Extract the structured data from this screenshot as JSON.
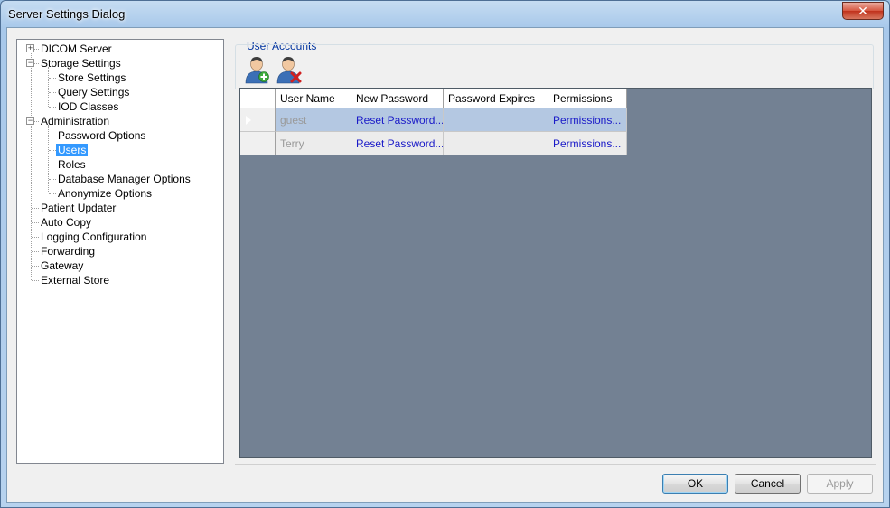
{
  "window": {
    "title": "Server Settings Dialog",
    "close_glyph": "✕"
  },
  "tree": {
    "nodes": [
      {
        "label": "DICOM Server",
        "level": 0,
        "expander": "+"
      },
      {
        "label": "Storage Settings",
        "level": 0,
        "expander": "−"
      },
      {
        "label": "Store Settings",
        "level": 1
      },
      {
        "label": "Query Settings",
        "level": 1
      },
      {
        "label": "IOD Classes",
        "level": 1
      },
      {
        "label": "Administration",
        "level": 0,
        "expander": "−"
      },
      {
        "label": "Password Options",
        "level": 1
      },
      {
        "label": "Users",
        "level": 1,
        "selected": true
      },
      {
        "label": "Roles",
        "level": 1
      },
      {
        "label": "Database Manager Options",
        "level": 1
      },
      {
        "label": "Anonymize Options",
        "level": 1
      },
      {
        "label": "Patient Updater",
        "level": 0
      },
      {
        "label": "Auto Copy",
        "level": 0
      },
      {
        "label": "Logging Configuration",
        "level": 0
      },
      {
        "label": "Forwarding",
        "level": 0
      },
      {
        "label": "Gateway",
        "level": 0
      },
      {
        "label": "External Store",
        "level": 0
      }
    ]
  },
  "user_accounts": {
    "group_title": "User Accounts",
    "add_user_icon": "add-user-icon",
    "delete_user_icon": "delete-user-icon",
    "columns": [
      "User Name",
      "New Password",
      "Password Expires",
      "Permissions"
    ],
    "rows": [
      {
        "user_name": "guest",
        "new_password": "Reset Password...",
        "password_expires": "",
        "permissions": "Permissions..."
      },
      {
        "user_name": "Terry",
        "new_password": "Reset Password...",
        "password_expires": "",
        "permissions": "Permissions..."
      }
    ]
  },
  "buttons": {
    "ok": "OK",
    "cancel": "Cancel",
    "apply": "Apply"
  },
  "colors": {
    "grid_background": "#738193",
    "selection": "#3399ff",
    "link": "#1a1ac8"
  }
}
